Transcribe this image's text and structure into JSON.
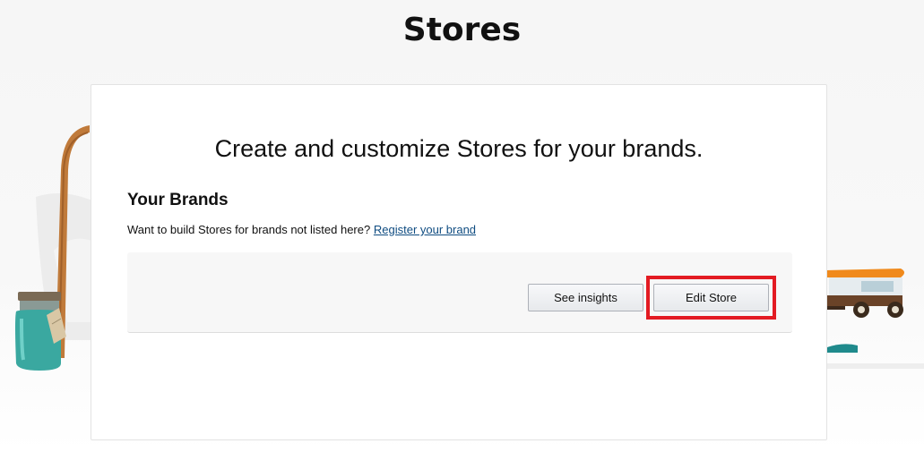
{
  "page": {
    "title": "Stores"
  },
  "card": {
    "headline": "Create and customize Stores for your brands.",
    "brands_heading": "Your Brands",
    "brands_note": "Want to build Stores for brands not listed here?",
    "register_link": "Register your brand"
  },
  "brand_row": {
    "see_insights_label": "See insights",
    "edit_store_label": "Edit Store"
  },
  "colors": {
    "highlight": "#e31b23",
    "link": "#0f4c81"
  }
}
